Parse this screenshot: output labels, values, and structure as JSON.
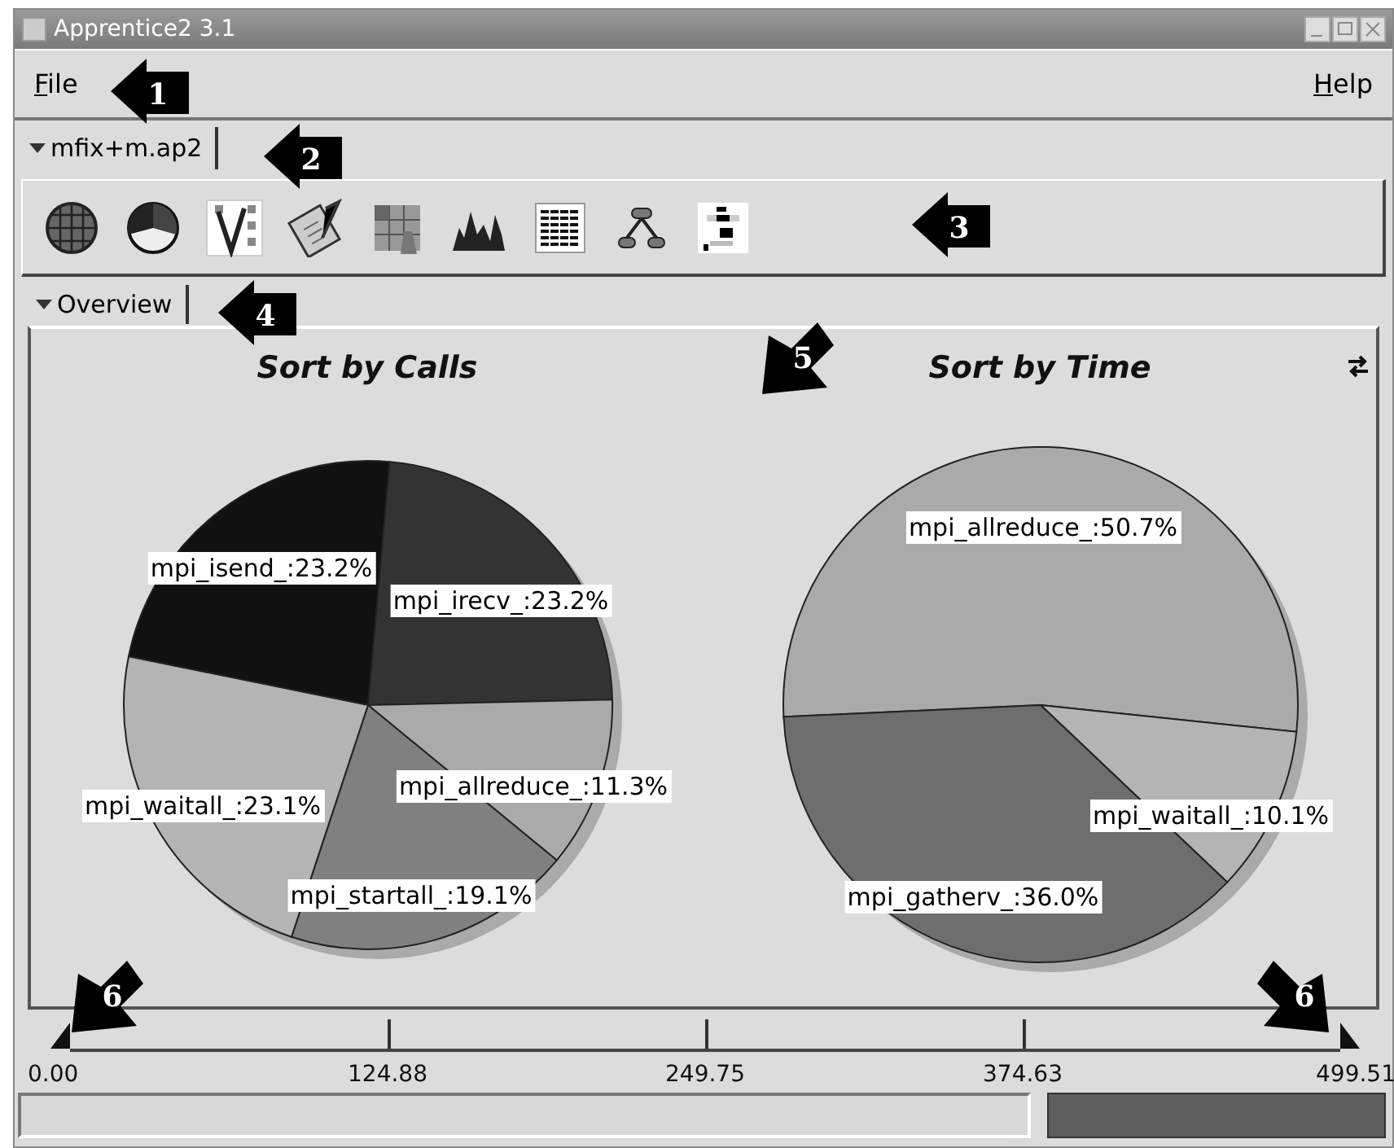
{
  "window": {
    "title": "Apprentice2 3.1"
  },
  "menu": [
    {
      "label": "File",
      "mnemonic_underlined": true
    },
    {
      "label": "Help",
      "mnemonic_underlined": true
    }
  ],
  "file_tab": {
    "label": "mfix+m.ap2",
    "expanded": true
  },
  "view_tab": {
    "label": "Overview",
    "expanded": true
  },
  "charts": [
    {
      "title": "Sort by Calls",
      "chart_data": {
        "type": "pie",
        "categories": [
          "mpi_isend_:23.2%",
          "mpi_irecv_:23.2%",
          "mpi_allreduce_:11.3%",
          "mpi_startall_:19.1%",
          "mpi_waitall_:23.1%"
        ],
        "values": [
          23.2,
          23.2,
          11.3,
          19.1,
          23.1
        ]
      }
    },
    {
      "title": "Sort by Time",
      "chart_data": {
        "type": "pie",
        "categories": [
          "mpi_allreduce_:50.7%",
          "mpi_waitall_:10.1%",
          "mpi_gatherv_:36.0%"
        ],
        "values": [
          50.7,
          10.1,
          36.0
        ]
      }
    }
  ],
  "timeline": {
    "ticks": [
      "0.00",
      "124.88",
      "249.75",
      "374.63",
      "499.51"
    ]
  },
  "callouts": [
    {
      "label": "1"
    },
    {
      "label": "2"
    },
    {
      "label": "3"
    },
    {
      "label": "4"
    },
    {
      "label": "5"
    },
    {
      "label": "6"
    },
    {
      "label": "6"
    }
  ]
}
